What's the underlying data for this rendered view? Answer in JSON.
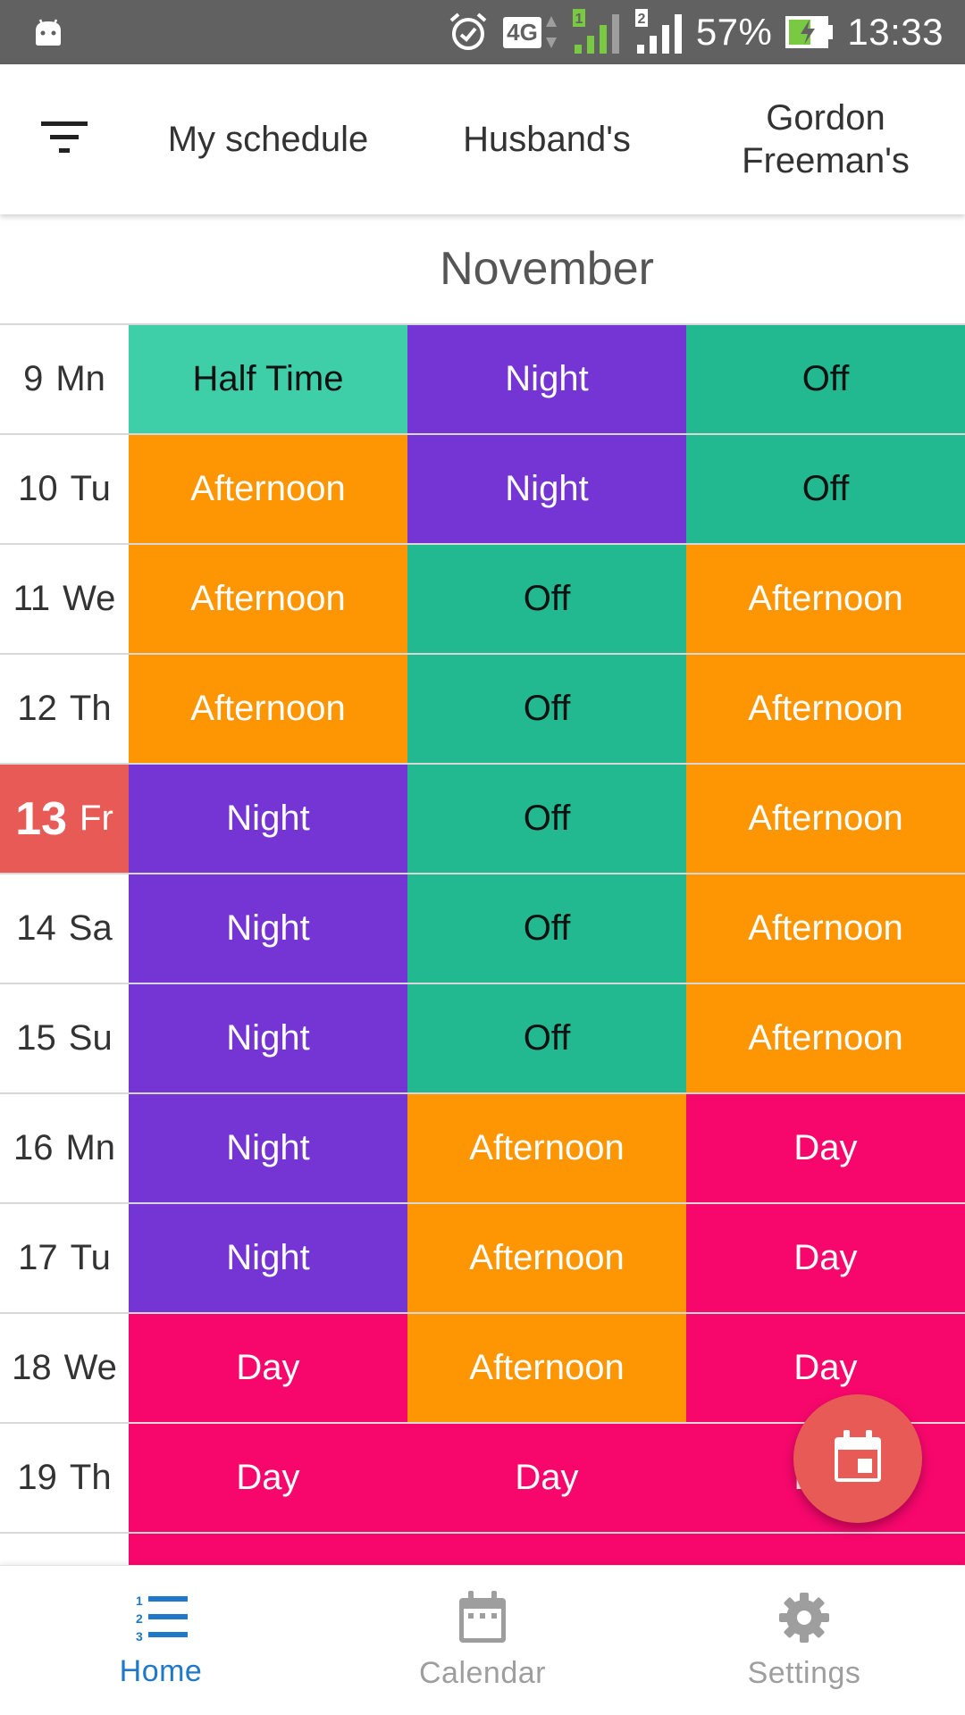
{
  "status_bar": {
    "network": "4G",
    "sim1": "1",
    "sim2": "2",
    "battery": "57%",
    "time": "13:33"
  },
  "tabs": [
    {
      "label": "My schedule"
    },
    {
      "label": "Husband's"
    },
    {
      "label_line1": "Gordon",
      "label_line2": "Freeman's"
    }
  ],
  "month": "November",
  "rows": [
    {
      "num": "9",
      "day": "Mn",
      "today": false,
      "shifts": [
        "Half Time",
        "Night",
        "Off"
      ]
    },
    {
      "num": "10",
      "day": "Tu",
      "today": false,
      "shifts": [
        "Afternoon",
        "Night",
        "Off"
      ]
    },
    {
      "num": "11",
      "day": "We",
      "today": false,
      "shifts": [
        "Afternoon",
        "Off",
        "Afternoon"
      ]
    },
    {
      "num": "12",
      "day": "Th",
      "today": false,
      "shifts": [
        "Afternoon",
        "Off",
        "Afternoon"
      ]
    },
    {
      "num": "13",
      "day": "Fr",
      "today": true,
      "shifts": [
        "Night",
        "Off",
        "Afternoon"
      ]
    },
    {
      "num": "14",
      "day": "Sa",
      "today": false,
      "shifts": [
        "Night",
        "Off",
        "Afternoon"
      ]
    },
    {
      "num": "15",
      "day": "Su",
      "today": false,
      "shifts": [
        "Night",
        "Off",
        "Afternoon"
      ]
    },
    {
      "num": "16",
      "day": "Mn",
      "today": false,
      "shifts": [
        "Night",
        "Afternoon",
        "Day"
      ]
    },
    {
      "num": "17",
      "day": "Tu",
      "today": false,
      "shifts": [
        "Night",
        "Afternoon",
        "Day"
      ]
    },
    {
      "num": "18",
      "day": "We",
      "today": false,
      "shifts": [
        "Day",
        "Afternoon",
        "Day"
      ]
    },
    {
      "num": "19",
      "day": "Th",
      "today": false,
      "shifts": [
        "Day",
        "Day",
        "Day"
      ]
    },
    {
      "num": "",
      "day": "",
      "today": false,
      "shifts": [
        "",
        "",
        ""
      ],
      "shift_types": [
        "Day",
        "Day",
        "Day"
      ]
    }
  ],
  "shift_colors": {
    "Half Time": {
      "bg": "#3ecfa9",
      "fg": "#111111"
    },
    "Night": {
      "bg": "#7435d4",
      "fg": "#ffffff"
    },
    "Off": {
      "bg": "#22b890",
      "fg": "#111111"
    },
    "Afternoon": {
      "bg": "#fe9503",
      "fg": "#ffffff"
    },
    "Day": {
      "bg": "#f7076c",
      "fg": "#ffffff"
    }
  },
  "colors": {
    "accent": "#e85a55",
    "nav_active": "#1f78c8",
    "nav_inactive": "#9e9e9e",
    "status_bar": "#616161"
  },
  "bottom_nav": [
    {
      "label": "Home",
      "icon": "numbered-list-icon",
      "active": true
    },
    {
      "label": "Calendar",
      "icon": "calendar-icon",
      "active": false
    },
    {
      "label": "Settings",
      "icon": "gear-icon",
      "active": false
    }
  ],
  "fab": {
    "icon": "calendar-today-icon"
  }
}
